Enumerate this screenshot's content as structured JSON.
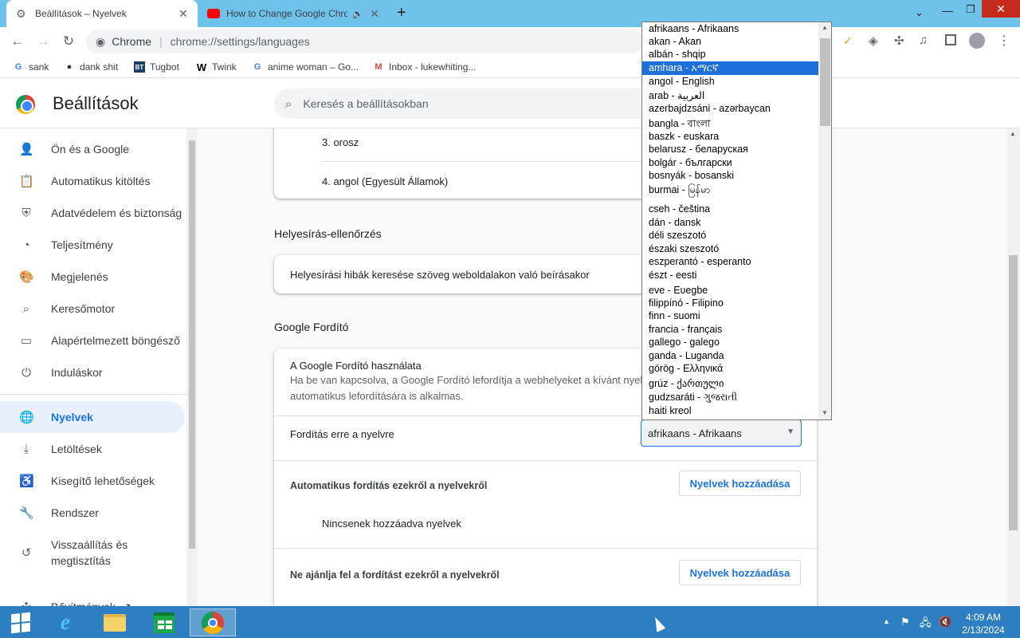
{
  "tabs": [
    {
      "title": "Beállítások – Nyelvek",
      "icon": "gear-icon"
    },
    {
      "title": "How to Change Google Chro",
      "icon": "youtube-icon"
    }
  ],
  "toolbar": {
    "chip": "Chrome",
    "url": "chrome://settings/languages"
  },
  "bookmarks": [
    {
      "label": "sank",
      "icon": "G"
    },
    {
      "label": "dank shit",
      "icon": "●"
    },
    {
      "label": "Tugbot",
      "icon": "BT"
    },
    {
      "label": "Twink",
      "icon": "W"
    },
    {
      "label": "anime woman – Go...",
      "icon": "G"
    },
    {
      "label": "Inbox - lukewhiting...",
      "icon": "M"
    }
  ],
  "header": {
    "title": "Beállítások",
    "search_placeholder": "Keresés a beállításokban"
  },
  "sidebar": {
    "items": [
      {
        "label": "Ön és a Google",
        "icon": "person-icon"
      },
      {
        "label": "Automatikus kitöltés",
        "icon": "clipboard-icon"
      },
      {
        "label": "Adatvédelem és biztonság",
        "icon": "shield-icon"
      },
      {
        "label": "Teljesítmény",
        "icon": "gauge-icon"
      },
      {
        "label": "Megjelenés",
        "icon": "palette-icon"
      },
      {
        "label": "Keresőmotor",
        "icon": "search-icon"
      },
      {
        "label": "Alapértelmezett böngésző",
        "icon": "browser-icon"
      },
      {
        "label": "Induláskor",
        "icon": "power-icon"
      },
      {
        "label": "Nyelvek",
        "icon": "globe-icon"
      },
      {
        "label": "Letöltések",
        "icon": "download-icon"
      },
      {
        "label": "Kisegítő lehetőségek",
        "icon": "accessibility-icon"
      },
      {
        "label": "Rendszer",
        "icon": "wrench-icon"
      },
      {
        "label": "Visszaállítás és megtisztítás",
        "icon": "restore-icon"
      },
      {
        "label": "Bővítmények",
        "icon": "puzzle-icon"
      }
    ]
  },
  "languages_card": {
    "items": [
      "3. orosz",
      "4. angol (Egyesült Államok)"
    ]
  },
  "spellcheck": {
    "heading": "Helyesírás-ellenőrzés",
    "text": "Helyesírási hibák keresése szöveg weboldalakon való beírásakor"
  },
  "translate": {
    "heading": "Google Fordító",
    "use_title": "A Google Fordító használata",
    "use_desc": "Ha be van kapcsolva, a Google Fordító lefordítja a webhelyeket a kívánt nyelv",
    "use_desc2": "automatikus lefordítására is alkalmas.",
    "target_label": "Fordítás erre a nyelvre",
    "target_value": "afrikaans - Afrikaans",
    "auto_label": "Automatikus fordítás ezekről a nyelvekről",
    "add_button": "Nyelvek hozzáadása",
    "none_text": "Nincsenek hozzáadva nyelvek",
    "never_label": "Ne ajánlja fel a fordítást ezekről a nyelvekről",
    "add_button2": "Nyelvek hozzáadása"
  },
  "dropdown": {
    "highlighted": "amhara - አማርኛ",
    "options": [
      "afrikaans - Afrikaans",
      "akan - Akan",
      "albán - shqip",
      "amhara - አማርኛ",
      "angol - English",
      "arab - العربية",
      "azerbajdzsáni - azərbaycan",
      "bangla - বাংলা",
      "baszk - euskara",
      "belarusz - беларуская",
      "bolgár - български",
      "bosnyák - bosanski",
      "burmai - မြန်မာ",
      "cseh - čeština",
      "dán - dansk",
      "déli szeszotó",
      "északi szeszotó",
      "eszperantó - esperanto",
      "észt - eesti",
      "eve - Eʋegbe",
      "filippínó - Filipino",
      "finn - suomi",
      "francia - français",
      "gallego - galego",
      "ganda - Luganda",
      "görög - Ελληνικά",
      "grúz - ქართული",
      "gudzsaráti - ગુજરાતી",
      "haiti kreol"
    ]
  },
  "taskbar": {
    "time": "4:09 AM",
    "date": "2/13/2024"
  }
}
